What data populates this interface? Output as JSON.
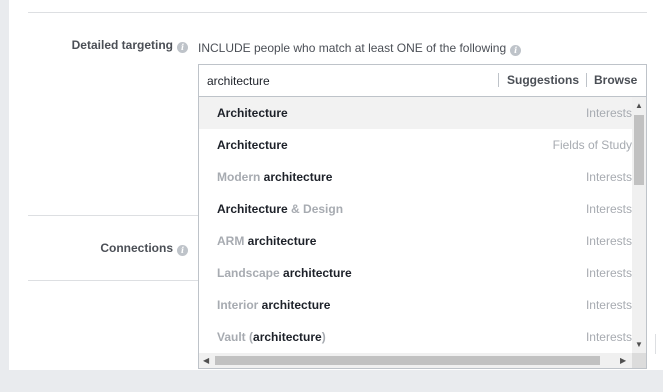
{
  "detailed_targeting": {
    "label": "Detailed targeting",
    "include_text": "INCLUDE people who match at least ONE of the following"
  },
  "connections": {
    "label": "Connections"
  },
  "search": {
    "value": "architecture",
    "suggestions_label": "Suggestions",
    "browse_label": "Browse"
  },
  "icons": {
    "info": "info-icon"
  },
  "results": [
    {
      "parts": [
        {
          "t": "Architecture",
          "s": "bold"
        }
      ],
      "type": "Interests",
      "highlighted": true
    },
    {
      "parts": [
        {
          "t": "Architecture",
          "s": "bold"
        }
      ],
      "type": "Fields of Study"
    },
    {
      "parts": [
        {
          "t": "Modern ",
          "s": "dim"
        },
        {
          "t": "architecture",
          "s": "bold"
        }
      ],
      "type": "Interests"
    },
    {
      "parts": [
        {
          "t": "Architecture",
          "s": "bold"
        },
        {
          "t": " & Design",
          "s": "dim"
        }
      ],
      "type": "Interests"
    },
    {
      "parts": [
        {
          "t": "ARM ",
          "s": "dim"
        },
        {
          "t": "architecture",
          "s": "bold"
        }
      ],
      "type": "Interests"
    },
    {
      "parts": [
        {
          "t": "Landscape ",
          "s": "dim"
        },
        {
          "t": "architecture",
          "s": "bold"
        }
      ],
      "type": "Interests"
    },
    {
      "parts": [
        {
          "t": "Interior ",
          "s": "dim"
        },
        {
          "t": "architecture",
          "s": "bold"
        }
      ],
      "type": "Interests"
    },
    {
      "parts": [
        {
          "t": "Vault ",
          "s": "dim"
        },
        {
          "t": "(",
          "s": "dim"
        },
        {
          "t": "architecture",
          "s": "bold"
        },
        {
          "t": ")",
          "s": "dim"
        }
      ],
      "type": "Interests"
    }
  ]
}
